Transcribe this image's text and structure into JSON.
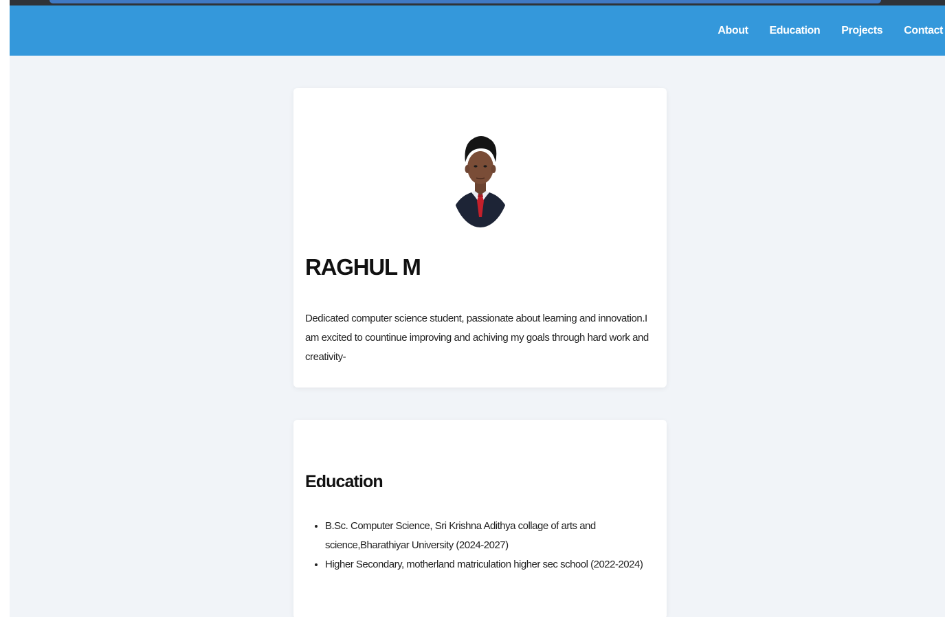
{
  "nav": {
    "items": [
      {
        "label": "About"
      },
      {
        "label": "Education"
      },
      {
        "label": "Projects"
      },
      {
        "label": "Contact"
      }
    ]
  },
  "profile": {
    "name": "RAGHUL M",
    "bio": "Dedicated computer science student, passionate about learning and innovation.I am excited to countinue improving and achiving my goals through hard work and creativity-"
  },
  "education": {
    "title": "Education",
    "items": [
      {
        "text": "B.Sc. Computer Science, Sri Krishna Adithya collage of arts and science,Bharathiyar University (2024-2027)"
      },
      {
        "text": "Higher Secondary, motherland matriculation higher sec school (2022-2024)"
      }
    ]
  },
  "colors": {
    "navbar": "#3498db",
    "background": "#f1f4f8",
    "card": "#ffffff",
    "text": "#111111"
  }
}
